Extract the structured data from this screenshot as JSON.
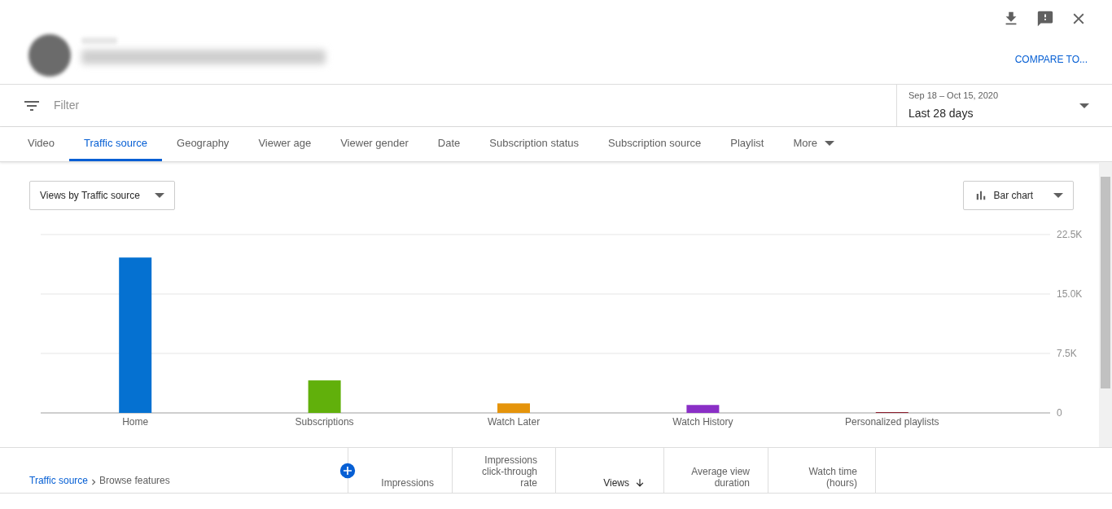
{
  "header": {
    "compare_link": "COMPARE TO..."
  },
  "filter": {
    "placeholder": "Filter"
  },
  "date_range": {
    "range": "Sep 18 – Oct 15, 2020",
    "label": "Last 28 days"
  },
  "tabs": [
    {
      "label": "Video",
      "selected": false
    },
    {
      "label": "Traffic source",
      "selected": true
    },
    {
      "label": "Geography",
      "selected": false
    },
    {
      "label": "Viewer age",
      "selected": false
    },
    {
      "label": "Viewer gender",
      "selected": false
    },
    {
      "label": "Date",
      "selected": false
    },
    {
      "label": "Subscription status",
      "selected": false
    },
    {
      "label": "Subscription source",
      "selected": false
    },
    {
      "label": "Playlist",
      "selected": false
    },
    {
      "label": "More",
      "selected": false
    }
  ],
  "metric_dropdown": "Views by Traffic source",
  "chart_type_dropdown": "Bar chart",
  "chart_data": {
    "type": "bar",
    "categories": [
      "Home",
      "Subscriptions",
      "Watch Later",
      "Watch History",
      "Personalized playlists"
    ],
    "values": [
      19600,
      4100,
      1200,
      1000,
      100
    ],
    "colors": [
      "#0571d1",
      "#61b00b",
      "#e5940b",
      "#8a2fc6",
      "#8b1a2b"
    ],
    "ylim": [
      0,
      22500
    ],
    "yticks": [
      {
        "value": 0,
        "label": "0"
      },
      {
        "value": 7500,
        "label": "7.5K"
      },
      {
        "value": 15000,
        "label": "15.0K"
      },
      {
        "value": 22500,
        "label": "22.5K"
      }
    ]
  },
  "table": {
    "breadcrumb": {
      "link": "Traffic source",
      "current": "Browse features"
    },
    "columns": [
      {
        "label": "Impressions",
        "sorted": false
      },
      {
        "label": "Impressions click-through rate",
        "sorted": false
      },
      {
        "label": "Views",
        "sorted": true
      },
      {
        "label": "Average view duration",
        "sorted": false
      },
      {
        "label": "Watch time (hours)",
        "sorted": false
      }
    ]
  }
}
